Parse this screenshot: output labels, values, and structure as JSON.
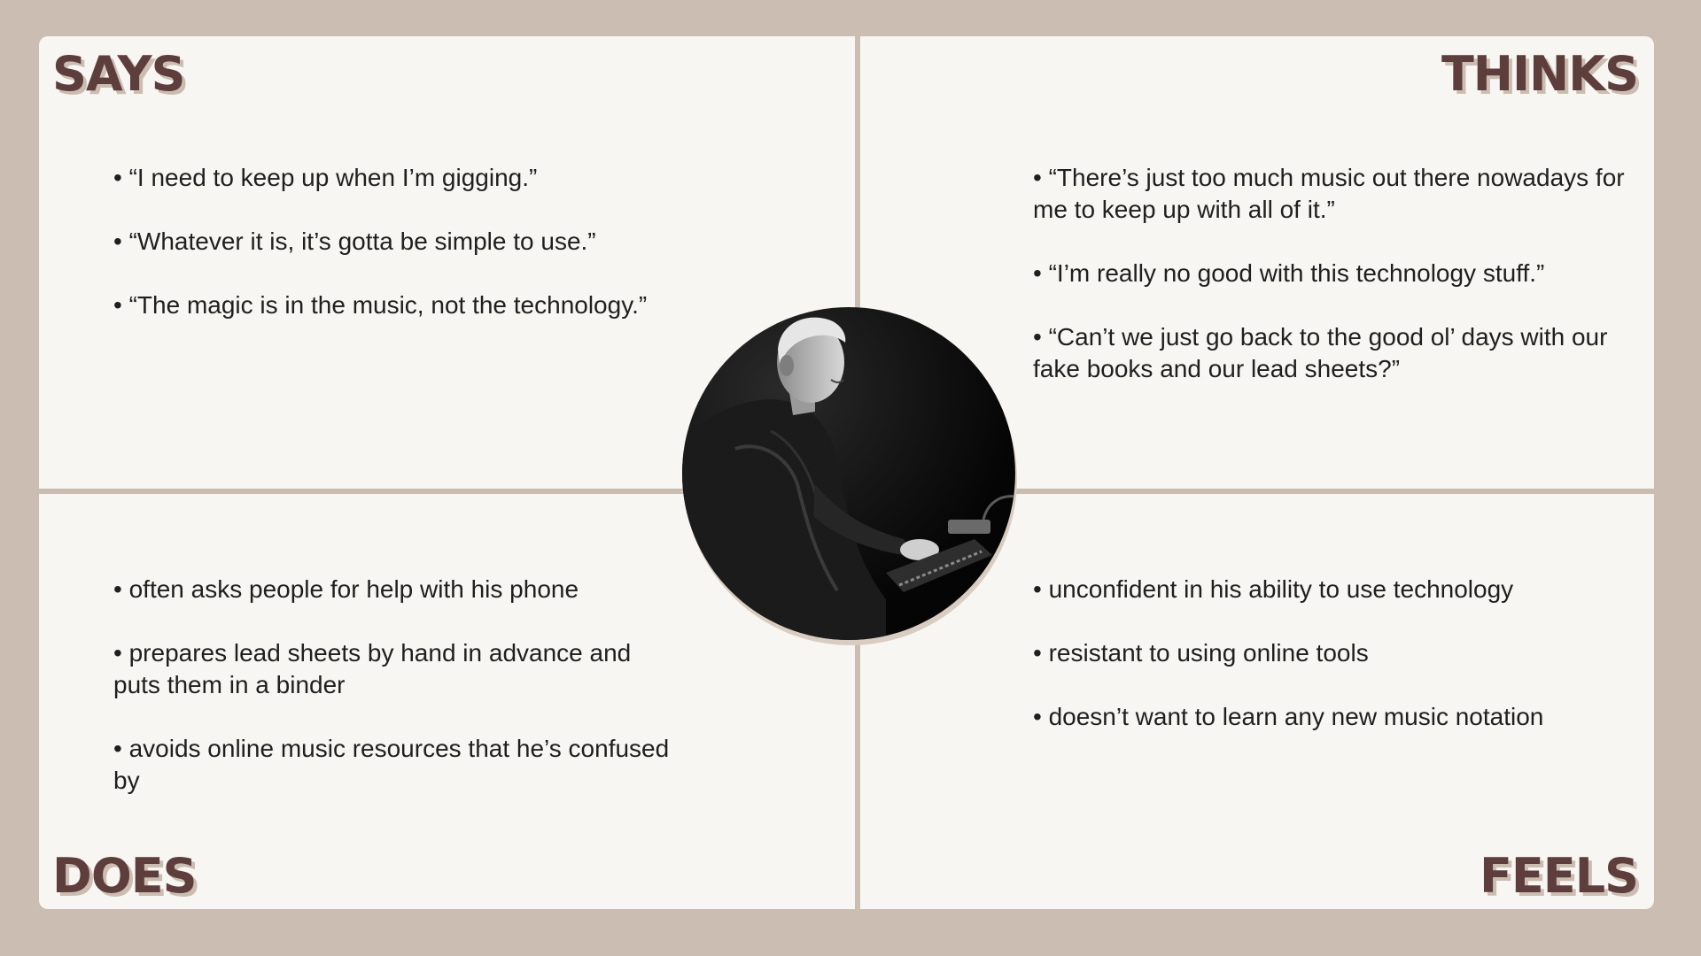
{
  "says": {
    "title": "SAYS",
    "items": [
      "“I need to keep up when I’m gigging.”",
      "“Whatever it is, it’s gotta be simple to use.”",
      "“The magic is in the music, not the technology.”"
    ]
  },
  "thinks": {
    "title": "THINKS",
    "items": [
      "“There’s just too much music out there nowadays for me to keep up with all of it.”",
      "“I’m really no good with this technology stuff.”",
      "“Can’t we just go back to the good ol’ days with our fake books and our lead sheets?”"
    ]
  },
  "does": {
    "title": "DOES",
    "items": [
      "often asks people for help with his phone",
      "prepares lead sheets by hand in advance and puts them in a binder",
      "avoids online music resources that he’s confused by"
    ]
  },
  "feels": {
    "title": "FEELS",
    "items": [
      "unconfident in his ability to use technology",
      "resistant to using online tools",
      "doesn’t want to learn any new music notation"
    ]
  },
  "colors": {
    "background": "#cbbdb1",
    "panel": "#f8f6f2",
    "heading": "#5e3d3d"
  }
}
